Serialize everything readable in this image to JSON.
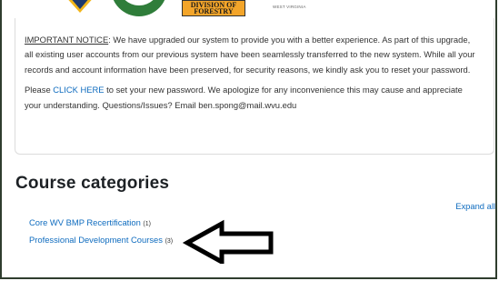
{
  "logos": {
    "forestry_line1": "DIVISION OF",
    "forestry_line2": "FORESTRY",
    "wv_text": "WEST VIRGINIA"
  },
  "notice": {
    "heading": "IMPORTANT NOTICE",
    "paragraph1_rest": ":  We have upgraded our system to provide you with a better experience. As part of this upgrade, all existing user accounts from our previous system have been seamlessly transferred to the new system.  While all your records and account information have been preserved, for security reasons, we kindly ask you to reset your password.",
    "paragraph2_prefix": "Please ",
    "click_here": "CLICK HERE",
    "paragraph2_rest": " to set your new password. We apologize for any inconvenience this may cause and appreciate your understanding.  Questions/Issues?  Email ",
    "email": "ben.spong@mail.wvu.edu"
  },
  "course_categories": {
    "title": "Course categories",
    "expand_all": "Expand all",
    "items": [
      {
        "name": "Core WV BMP Recertification",
        "count": "(1)"
      },
      {
        "name": "Professional Development Courses",
        "count": "(3)"
      }
    ]
  },
  "colors": {
    "link": "#0f6cbf",
    "frame": "#2f3d2e",
    "arrow": "#000000"
  },
  "icons": [
    "left-arrow-annotation"
  ]
}
